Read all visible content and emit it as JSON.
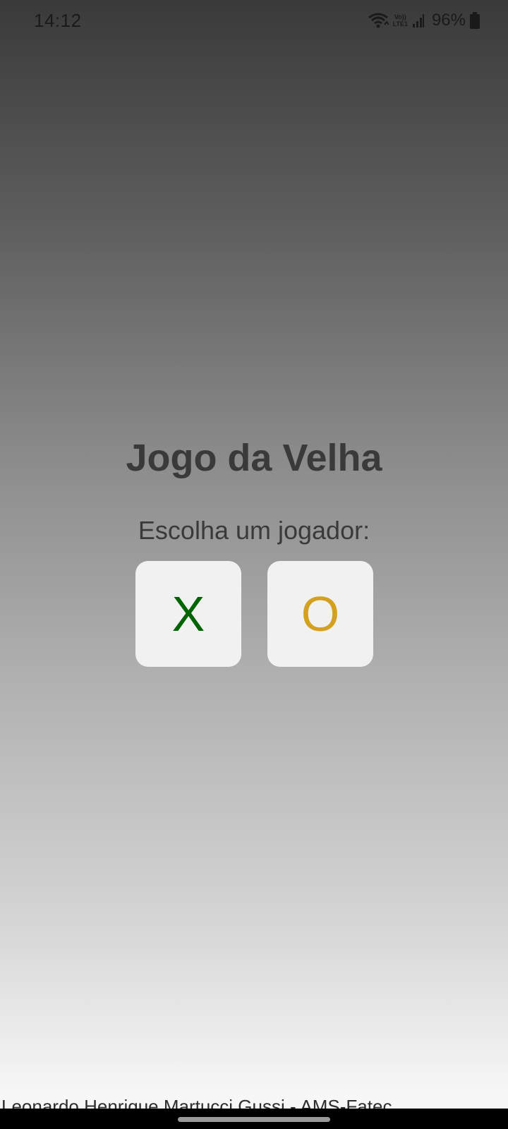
{
  "status_bar": {
    "time": "14:12",
    "network_label_top": "Vo))",
    "network_label_bottom": "LTE1",
    "battery_percent": "96%",
    "icons": [
      "wifi-icon",
      "signal-icon",
      "battery-icon"
    ]
  },
  "game": {
    "title": "Jogo da Velha",
    "prompt": "Escolha um jogador:",
    "choices": [
      {
        "label": "X",
        "color": "#006400"
      },
      {
        "label": "O",
        "color": "#d4a020"
      }
    ]
  },
  "footer": {
    "credit": "Leonardo Henrique Martucci Gussi - AMS-Fatec"
  }
}
